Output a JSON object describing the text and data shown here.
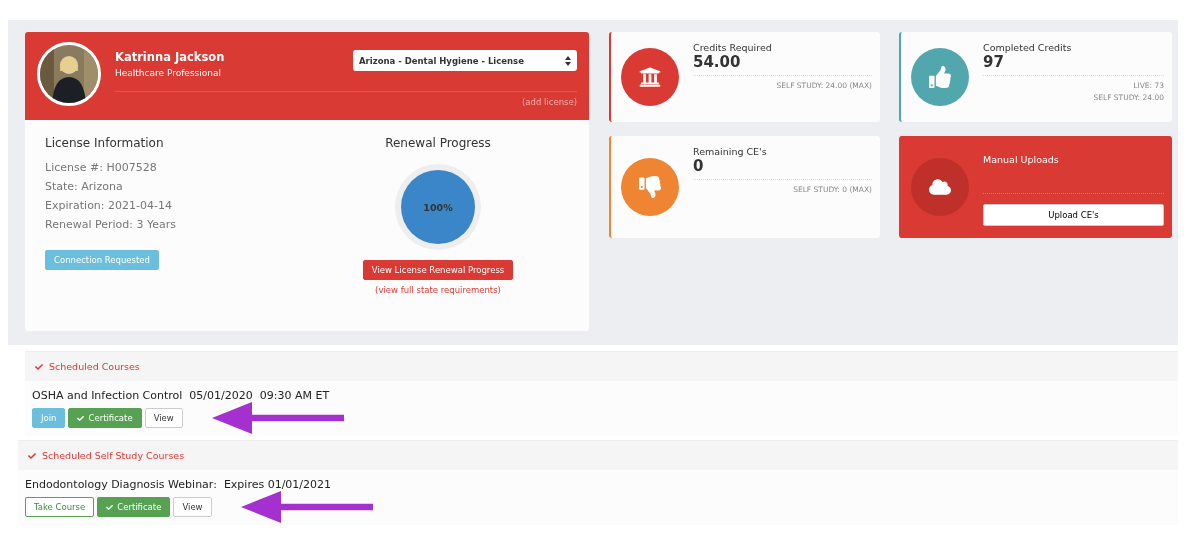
{
  "profile": {
    "name": "Katrinna Jackson",
    "role": "Healthcare Professional",
    "license_select": "Arizona - Dental Hygiene - License",
    "add_license": "(add license)"
  },
  "license_info": {
    "title": "License Information",
    "lines": [
      "License #: H007528",
      "State: Arizona",
      "Expiration: 2021-04-14",
      "Renewal Period: 3 Years"
    ],
    "button": "Connection Requested"
  },
  "renewal": {
    "title": "Renewal Progress",
    "level": 1,
    "reading": "100%",
    "button": "View License Renewal Progress",
    "link": "(view full state requirements)"
  },
  "stats": [
    {
      "kind": "stat",
      "color": "#d93a33",
      "label": "Credits Required",
      "value": "54.00",
      "notes": [
        "SELF STUDY: 24.00 (MAX)"
      ]
    },
    {
      "kind": "stat",
      "color": "#52a6ad",
      "label": "Completed Credits",
      "value": "97",
      "notes": [
        "LIVE: 73",
        "SELF STUDY: 24.00"
      ]
    },
    {
      "kind": "stat",
      "color": "#ef8432",
      "label": "Remaining CE's",
      "value": "0",
      "notes": [
        "SELF STUDY: 0 (MAX)"
      ]
    },
    {
      "kind": "upload",
      "color": "#d93a33",
      "label": "Manual Uploads",
      "button": "Upload CE's"
    }
  ],
  "sections": [
    {
      "title": "Scheduled Courses",
      "course": "OSHA and Infection Control  05/01/2020  09:30 AM ET",
      "buttons": [
        {
          "kind": "join",
          "label": "Join"
        },
        {
          "kind": "certificate",
          "label": "Certificate"
        },
        {
          "kind": "view",
          "label": "View"
        }
      ]
    },
    {
      "title": "Scheduled Self Study Courses",
      "course": "Endodontology Diagnosis Webinar:  Expires 01/01/2021",
      "buttons": [
        {
          "kind": "take",
          "label": "Take Course"
        },
        {
          "kind": "certificate",
          "label": "Certificate"
        },
        {
          "kind": "view",
          "label": "View"
        }
      ]
    }
  ]
}
